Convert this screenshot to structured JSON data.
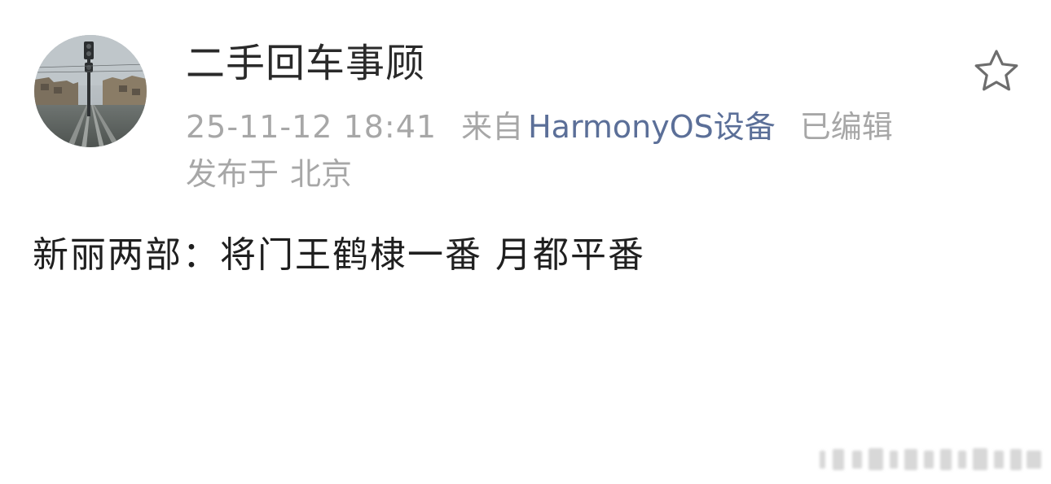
{
  "post": {
    "author": {
      "name": "二手回车事顾",
      "avatar_icon": "railway-avatar"
    },
    "meta": {
      "time": "25-11-12 18:41",
      "source_prefix": "来自",
      "source_device": "HarmonyOS设备",
      "edited": "已编辑"
    },
    "location": {
      "prefix": "发布于",
      "name": "北京"
    },
    "content": "新丽两部：将门王鹤棣一番 月都平番",
    "favorite_icon": "star-outline-icon"
  },
  "colors": {
    "background": "#ffffff",
    "username": "#2a2a2a",
    "meta_gray": "#a7a7a7",
    "device_blue": "#5b6f98",
    "content_text": "#1f1f1f"
  }
}
